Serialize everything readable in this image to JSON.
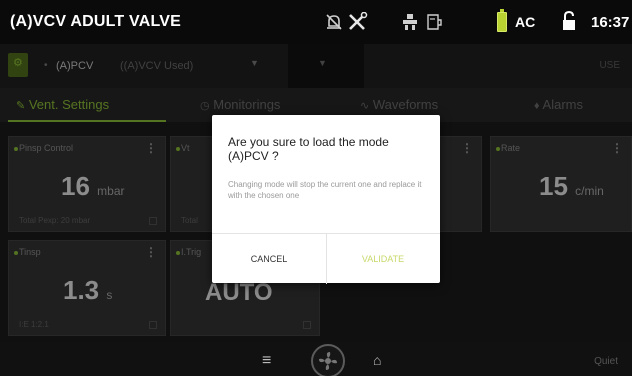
{
  "status": {
    "mode_title": "(A)VCV ADULT VALVE",
    "ac_label": "AC",
    "time": "16:37",
    "battery_color": "#b9d430"
  },
  "mode_row": {
    "current_mode": "(A)PCV",
    "mode_used": "((A)VCV Used)",
    "right_text": "USE"
  },
  "tabs": [
    {
      "label": "Vent. Settings",
      "active": true
    },
    {
      "label": "Monitorings",
      "active": false
    },
    {
      "label": "Waveforms",
      "active": false
    },
    {
      "label": "Alarms",
      "active": false
    }
  ],
  "cards": {
    "pinsp": {
      "label": "Pinsp Control",
      "value": "16",
      "unit": "mbar",
      "footer": "Total Pexp: 20 mbar"
    },
    "vt": {
      "label": "Vt",
      "footer": "Total"
    },
    "p3": {
      "label": ""
    },
    "rate": {
      "label": "Rate",
      "value": "15",
      "unit": "c/min"
    },
    "tinsp": {
      "label": "Tinsp",
      "value": "1.3",
      "unit": "s",
      "footer": "I:E 1:2.1"
    },
    "trigger": {
      "label": "I.Trig",
      "value": "AUTO"
    }
  },
  "dialog": {
    "title": "Are you sure to load the mode (A)PCV ?",
    "message": "Changing mode will stop the current one and replace it with the chosen one",
    "cancel_label": "CANCEL",
    "validate_label": "VALIDATE"
  },
  "bottom": {
    "right_text": "Quiet"
  },
  "colors": {
    "accent": "#9cd43c",
    "card_bg": "#3a3a3a"
  }
}
